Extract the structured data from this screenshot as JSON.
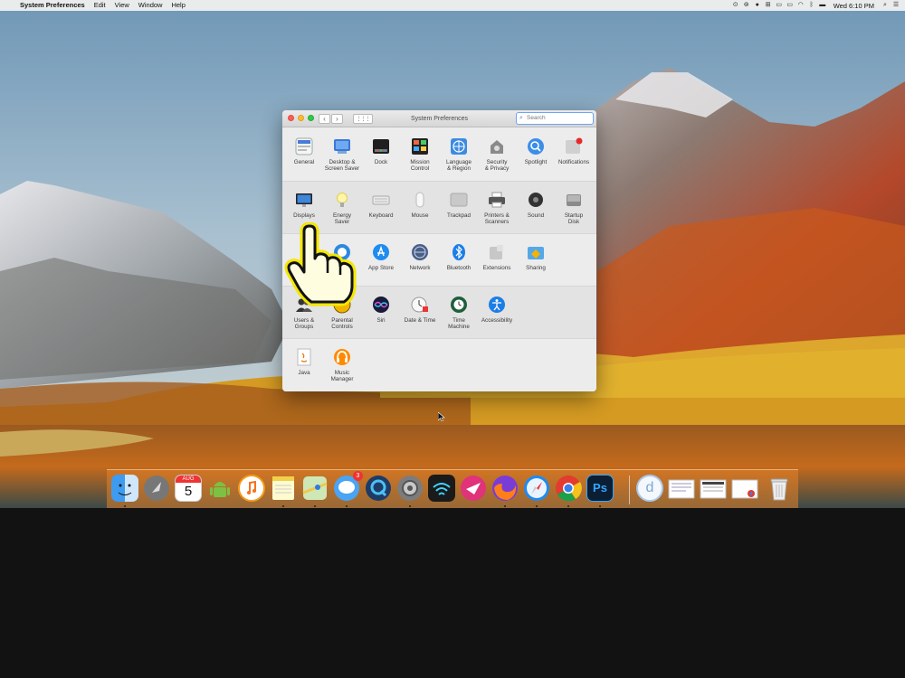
{
  "menubar": {
    "apple": "",
    "app_name": "System Preferences",
    "items": [
      "Edit",
      "View",
      "Window",
      "Help"
    ],
    "status_icons": [
      "lastpass-icon",
      "sync-icon",
      "evernote-icon",
      "spaces-icon",
      "window-icon",
      "airplay-icon",
      "wifi-icon",
      "bluetooth-icon",
      "battery-icon"
    ],
    "clock": "Wed 6:10 PM",
    "search_glyph": "⌕",
    "menu_glyph": "☰"
  },
  "window": {
    "title": "System Preferences",
    "back": "‹",
    "forward": "›",
    "show_all": "⋮⋮⋮",
    "search_icon": "⌕",
    "search_placeholder": "Search"
  },
  "panes": {
    "general": "General",
    "desktop": "Desktop &\nScreen Saver",
    "dock": "Dock",
    "mission_control": "Mission\nControl",
    "language": "Language\n& Region",
    "security": "Security\n& Privacy",
    "spotlight": "Spotlight",
    "notifications": "Notifications",
    "displays": "Displays",
    "energy": "Energy\nSaver",
    "keyboard": "Keyboard",
    "mouse": "Mouse",
    "trackpad": "Trackpad",
    "printers": "Printers &\nScanners",
    "sound": "Sound",
    "startup": "Startup\nDisk",
    "internet_accounts": "",
    "app_store": "App Store",
    "network": "Network",
    "bluetooth": "Bluetooth",
    "extensions": "Extensions",
    "sharing": "Sharing",
    "users": "Users &\nGroups",
    "parental": "Parental\nControls",
    "siri": "Siri",
    "datetime": "Date & Time",
    "time_machine": "Time\nMachine",
    "accessibility": "Accessibility",
    "java": "Java",
    "music_manager": "Music\nManager"
  },
  "dock": {
    "calendar_month": "AUG",
    "calendar_day": "5",
    "messages_badge": "3",
    "photoshop_label": "Ps",
    "downloads_label": "d"
  },
  "colors": {
    "menubar_bg": "#eeeeee",
    "window_bg": "#ececec",
    "search_focus": "#6da4f5",
    "dock_tint": "#e48228",
    "hand_fill": "#fffde0",
    "hand_glow": "#f4e600"
  }
}
